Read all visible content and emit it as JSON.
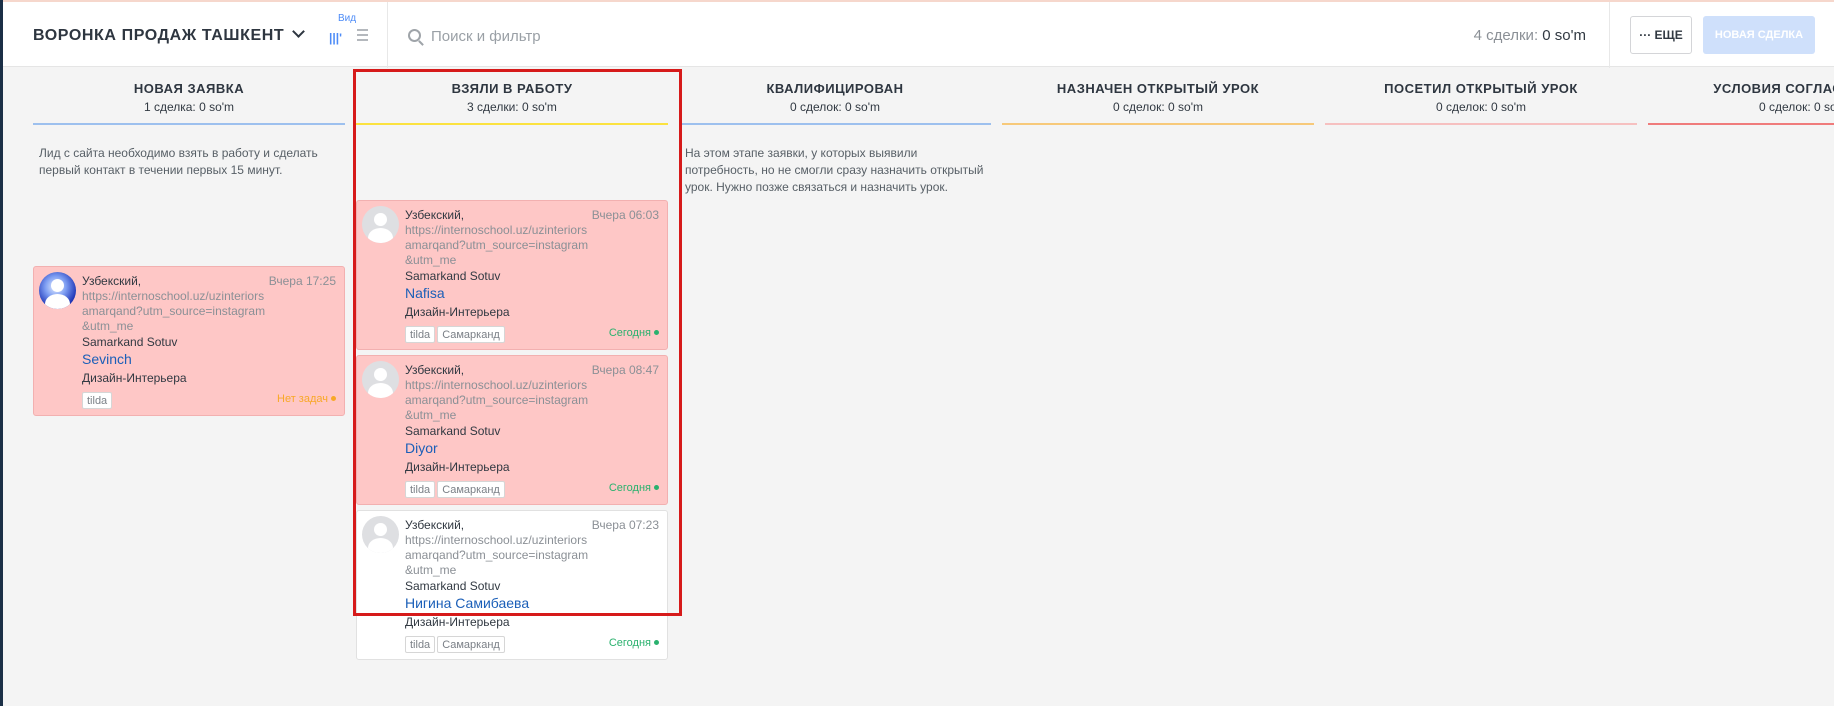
{
  "header": {
    "pipeline_name": "ВОРОНКА ПРОДАЖ ТАШКЕНТ",
    "view_label": "Вид",
    "view_kanban_glyph": "|||'",
    "search_placeholder": "Поиск и фильтр",
    "summary_count": "4 сделки:",
    "summary_amount": "0 so'm",
    "more_label": "··· ЕЩЕ",
    "new_deal_label": "НОВАЯ СДЕЛКА"
  },
  "colors": {
    "accent": "#4c8bf7",
    "card_overdue_bg": "#fec7c6",
    "highlight_border": "#d61a1a",
    "status_green": "#2ab16e",
    "status_orange": "#f8a827"
  },
  "columns": [
    {
      "title": "НОВАЯ ЗАЯВКА",
      "count": "1 сделка: 0 so'm",
      "line_color": "#9dc0ee",
      "description": "Лид с сайта необходимо взять в работу и сделать первый контакт в течении первых 15 минут.",
      "cards": [
        {
          "company": "Узбекский,",
          "time": "Вчера 17:25",
          "url": "https://internoschool.uz/uzinteriorsamarqand?utm_source=instagram&utm_me",
          "source": "Samarkand Sotuv",
          "contact": "Sevinch",
          "product": "Дизайн-Интерьера",
          "tags": [
            "tilda"
          ],
          "status": "Нет задач",
          "status_color": "#f8a827",
          "highlighted": true,
          "avatar": "photo"
        }
      ]
    },
    {
      "title": "ВЗЯЛИ В РАБОТУ",
      "count": "3 сделки: 0 so'm",
      "line_color": "#fbe240",
      "description": "",
      "cards": [
        {
          "company": "Узбекский,",
          "time": "Вчера 06:03",
          "url": "https://internoschool.uz/uzinteriorsamarqand?utm_source=instagram&utm_me",
          "source": "Samarkand Sotuv",
          "contact": "Nafisa",
          "product": "Дизайн-Интерьера",
          "tags": [
            "tilda",
            "Самарканд"
          ],
          "status": "Сегодня",
          "status_color": "#2ab16e",
          "highlighted": true,
          "avatar": "placeholder"
        },
        {
          "company": "Узбекский,",
          "time": "Вчера 08:47",
          "url": "https://internoschool.uz/uzinteriorsamarqand?utm_source=instagram&utm_me",
          "source": "Samarkand Sotuv",
          "contact": "Diyor",
          "product": "Дизайн-Интерьера",
          "tags": [
            "tilda",
            "Самарканд"
          ],
          "status": "Сегодня",
          "status_color": "#2ab16e",
          "highlighted": true,
          "avatar": "placeholder"
        },
        {
          "company": "Узбекский,",
          "time": "Вчера 07:23",
          "url": "https://internoschool.uz/uzinteriorsamarqand?utm_source=instagram&utm_me",
          "source": "Samarkand Sotuv",
          "contact": "Нигина Самибаева",
          "product": "Дизайн-Интерьера",
          "tags": [
            "tilda",
            "Самарканд"
          ],
          "status": "Сегодня",
          "status_color": "#2ab16e",
          "highlighted": false,
          "avatar": "placeholder"
        }
      ]
    },
    {
      "title": "КВАЛИФИЦИРОВАН",
      "count": "0 сделок: 0 so'm",
      "line_color": "#9dc0ee",
      "description": "На этом этапе заявки, у которых выявили потребность, но не смогли сразу назначить открытый урок. Нужно позже связаться и назначить урок.",
      "cards": []
    },
    {
      "title": "НАЗНАЧЕН ОТКРЫТЫЙ УРОК",
      "count": "0 сделок: 0 so'm",
      "line_color": "#f7c97a",
      "description": "",
      "cards": []
    },
    {
      "title": "ПОСЕТИЛ ОТКРЫТЫЙ УРОК",
      "count": "0 сделок: 0 so'm",
      "line_color": "#f6c0c0",
      "description": "",
      "cards": []
    },
    {
      "title": "УСЛОВИЯ СОГЛАСОВАНЫ",
      "count": "0 сделок: 0 so'm",
      "line_color": "#ef7b7b",
      "description": "",
      "cards": []
    }
  ]
}
